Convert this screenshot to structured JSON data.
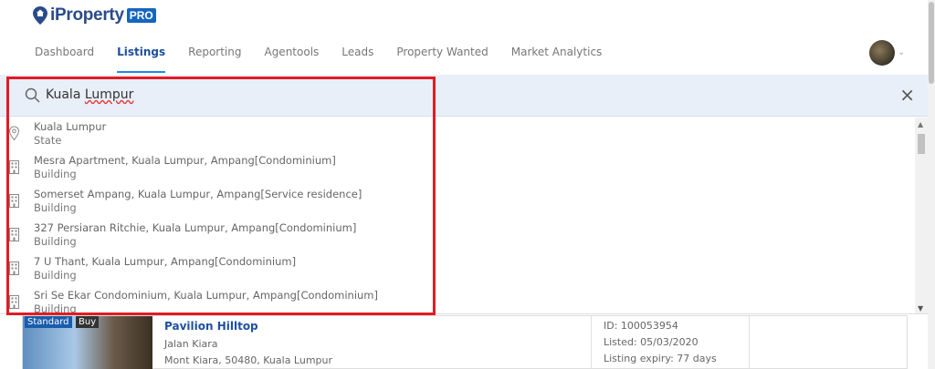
{
  "header": {
    "logo_text": "iProperty",
    "logo_badge": "PRO"
  },
  "nav": {
    "items": [
      {
        "label": "Dashboard",
        "active": false
      },
      {
        "label": "Listings",
        "active": true
      },
      {
        "label": "Reporting",
        "active": false
      },
      {
        "label": "Agentools",
        "active": false
      },
      {
        "label": "Leads",
        "active": false
      },
      {
        "label": "Property Wanted",
        "active": false
      },
      {
        "label": "Market Analytics",
        "active": false
      }
    ]
  },
  "search": {
    "value_part1": "Kuala ",
    "value_part2": "Lumpur",
    "value": "Kuala Lumpur"
  },
  "suggestions": [
    {
      "name": "Kuala Lumpur",
      "type": "State",
      "icon": "location-pin-icon"
    },
    {
      "name": "Mesra Apartment, Kuala Lumpur, Ampang[Condominium]",
      "type": "Building",
      "icon": "building-icon"
    },
    {
      "name": "Somerset Ampang, Kuala Lumpur, Ampang[Service residence]",
      "type": "Building",
      "icon": "building-icon"
    },
    {
      "name": "327 Persiaran Ritchie, Kuala Lumpur, Ampang[Condominium]",
      "type": "Building",
      "icon": "building-icon"
    },
    {
      "name": "7 U Thant, Kuala Lumpur, Ampang[Condominium]",
      "type": "Building",
      "icon": "building-icon"
    },
    {
      "name": "Sri Se Ekar Condominium, Kuala Lumpur, Ampang[Condominium]",
      "type": "Building",
      "icon": "building-icon"
    }
  ],
  "listing": {
    "badge_standard": "Standard",
    "badge_buy": "Buy",
    "title": "Pavilion Hilltop",
    "address_line1": "Jalan Kiara",
    "address_line2": "Mont Kiara, 50480, Kuala Lumpur",
    "id": "ID: 100053954",
    "listed": "Listed: 05/03/2020",
    "expiry": "Listing expiry: 77 days"
  },
  "colors": {
    "brand": "#2b4a8a",
    "accent": "#1e88e5",
    "highlight": "#e21b23"
  }
}
